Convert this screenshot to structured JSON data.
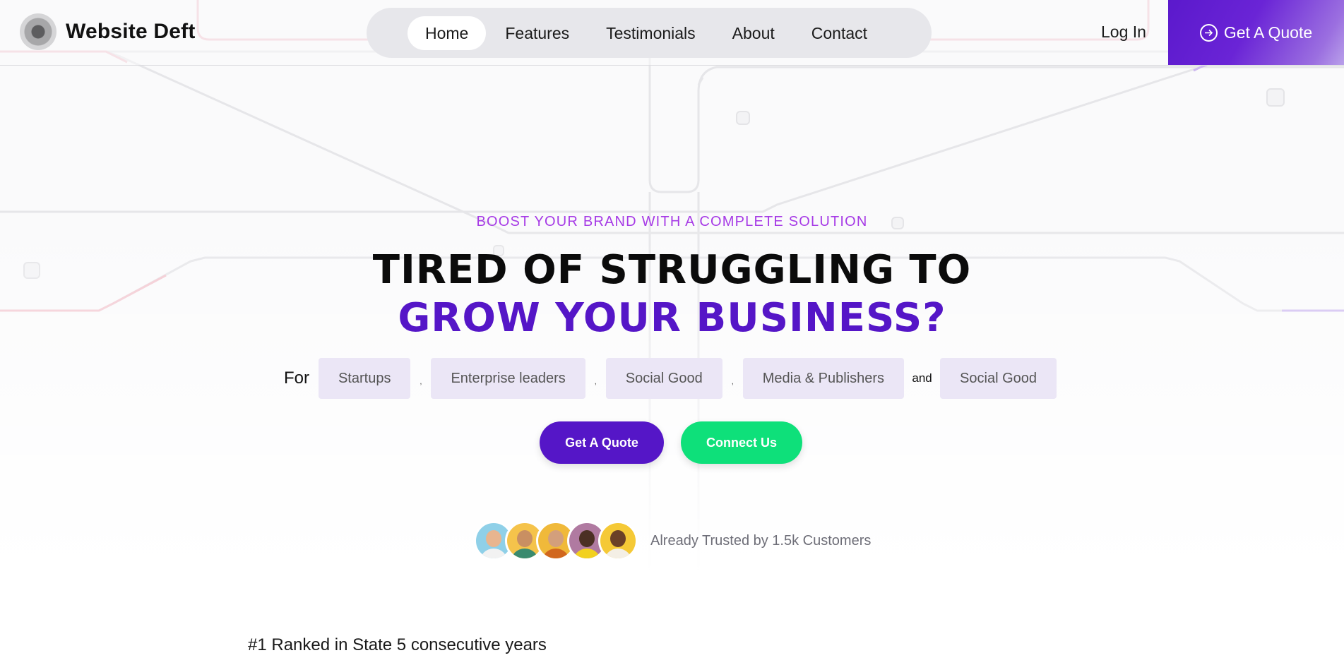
{
  "header": {
    "brand": "Website Deft",
    "nav": [
      {
        "label": "Home",
        "active": true
      },
      {
        "label": "Features",
        "active": false
      },
      {
        "label": "Testimonials",
        "active": false
      },
      {
        "label": "About",
        "active": false
      },
      {
        "label": "Contact",
        "active": false
      }
    ],
    "login_label": "Log In",
    "quote_label": "Get A Quote",
    "quote_icon": "arrow-circle-right-icon"
  },
  "hero": {
    "eyebrow": "BOOST YOUR BRAND WITH A COMPLETE SOLUTION",
    "headline_line1": "TIRED OF STRUGGLING TO",
    "headline_line2": "GROW YOUR BUSINESS?",
    "for_label": "For",
    "audiences": [
      "Startups",
      "Enterprise leaders",
      "Social Good",
      "Media & Publishers",
      "Social Good"
    ],
    "separator": ",",
    "and_label": "and",
    "cta_quote": "Get A Quote",
    "cta_connect": "Connect Us"
  },
  "trust": {
    "text": "Already Trusted by 1.5k Customers",
    "avatar_count": 5
  },
  "ranked_text": "#1 Ranked in State 5 consecutive years",
  "colors": {
    "accent_purple": "#5516c7",
    "eyebrow_purple": "#a63ae6",
    "green": "#0ee07a",
    "chip_bg": "#ebe6f6",
    "nav_pill_bg": "#e7e7eb"
  }
}
